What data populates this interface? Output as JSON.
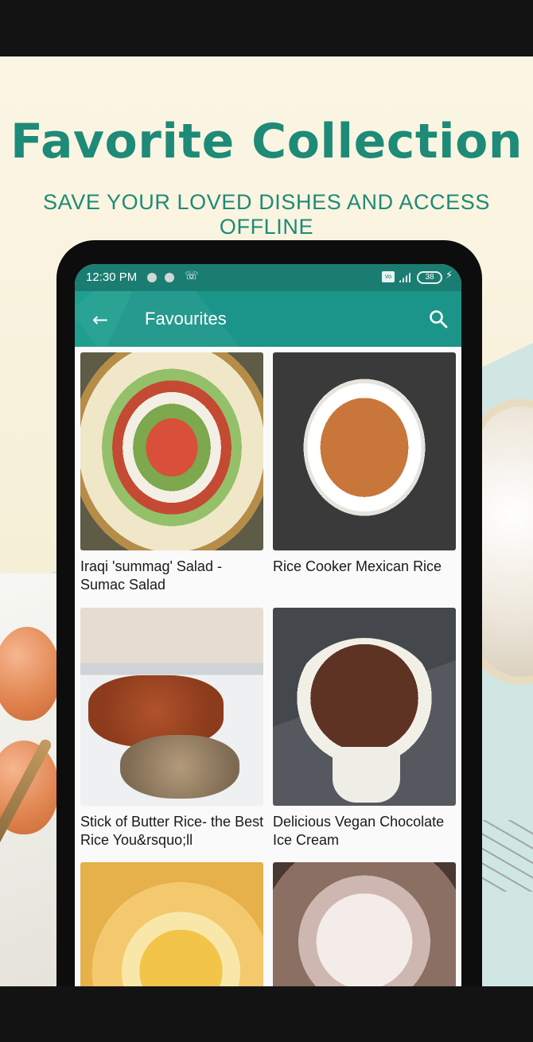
{
  "promo": {
    "headline": "Favorite Collection",
    "subheadline": "SAVE YOUR LOVED DISHES AND ACCESS OFFLINE",
    "headline_color": "#1e8a78"
  },
  "status_bar": {
    "time": "12:30 PM",
    "battery": "38",
    "background": "#1b7d72"
  },
  "app_bar": {
    "title": "Favourites",
    "back_icon": "arrow-left-icon",
    "search_icon": "search-icon",
    "background": "#1b958a"
  },
  "recipes": [
    {
      "title": "Iraqi 'summag' Salad - Sumac Salad"
    },
    {
      "title": "Rice Cooker Mexican Rice"
    },
    {
      "title": "Stick of Butter Rice- the Best Rice You&rsquo;ll"
    },
    {
      "title": "Delicious Vegan Chocolate Ice Cream"
    },
    {
      "title": ""
    },
    {
      "title": ""
    }
  ]
}
